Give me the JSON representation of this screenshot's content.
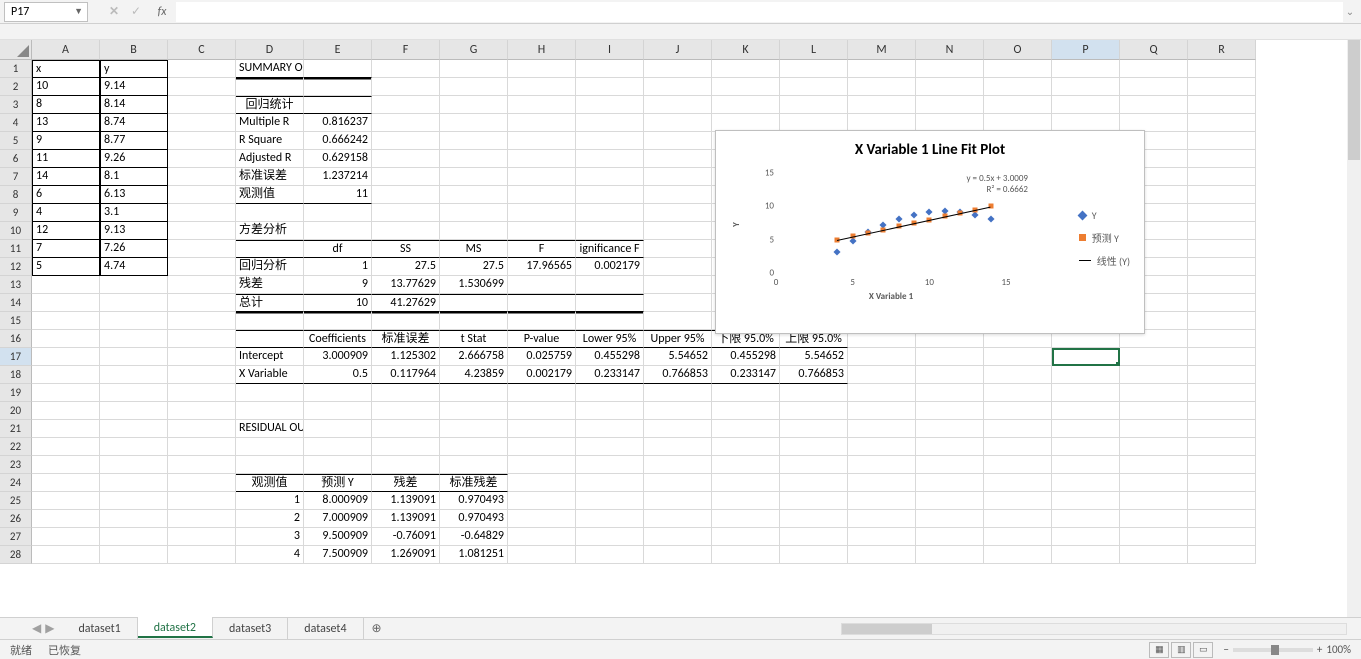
{
  "name_box": "P17",
  "formula": "",
  "fx_label": "fx",
  "columns": [
    "A",
    "B",
    "C",
    "D",
    "E",
    "F",
    "G",
    "H",
    "I",
    "J",
    "K",
    "L",
    "M",
    "N",
    "O",
    "P",
    "Q",
    "R"
  ],
  "rows": 28,
  "selected_col": 15,
  "selected_row": 17,
  "grid": {
    "A1": "x",
    "B1": "y",
    "A2": "10",
    "B2": "9.14",
    "A3": "8",
    "B3": "8.14",
    "A4": "13",
    "B4": "8.74",
    "A5": "9",
    "B5": "8.77",
    "A6": "11",
    "B6": "9.26",
    "A7": "14",
    "B7": "8.1",
    "A8": "6",
    "B8": "6.13",
    "A9": "4",
    "B9": "3.1",
    "A10": "12",
    "B10": "9.13",
    "A11": "7",
    "B11": "7.26",
    "A12": "5",
    "B12": "4.74",
    "D1": "SUMMARY OUTPUT",
    "D3": "回归统计",
    "D4": "Multiple R",
    "E4": "0.816237",
    "D5": "R Square",
    "E5": "0.666242",
    "D6": "Adjusted R",
    "E6": "0.629158",
    "D7": "标准误差",
    "E7": "1.237214",
    "D8": "观测值",
    "E8": "11",
    "D10": "方差分析",
    "E11": "df",
    "F11": "SS",
    "G11": "MS",
    "H11": "F",
    "I11": "ignificance F",
    "D12": "回归分析",
    "E12": "1",
    "F12": "27.5",
    "G12": "27.5",
    "H12": "17.96565",
    "I12": "0.002179",
    "D13": "残差",
    "E13": "9",
    "F13": "13.77629",
    "G13": "1.530699",
    "D14": "总计",
    "E14": "10",
    "F14": "41.27629",
    "E16": "Coefficients",
    "F16": "标准误差",
    "G16": "t Stat",
    "H16": "P-value",
    "I16": "Lower 95%",
    "J16": "Upper 95%",
    "K16": "下限 95.0%",
    "L16": "上限 95.0%",
    "D17": "Intercept",
    "E17": "3.000909",
    "F17": "1.125302",
    "G17": "2.666758",
    "H17": "0.025759",
    "I17": "0.455298",
    "J17": "5.54652",
    "K17": "0.455298",
    "L17": "5.54652",
    "D18": "X Variable",
    "E18": "0.5",
    "F18": "0.117964",
    "G18": "4.23859",
    "H18": "0.002179",
    "I18": "0.233147",
    "J18": "0.766853",
    "K18": "0.233147",
    "L18": "0.766853",
    "D21": "RESIDUAL OUTPUT",
    "D24": "观测值",
    "E24": "预测 Y",
    "F24": "残差",
    "G24": "标准残差",
    "D25": "1",
    "E25": "8.000909",
    "F25": "1.139091",
    "G25": "0.970493",
    "D26": "2",
    "E26": "7.000909",
    "F26": "1.139091",
    "G26": "0.970493",
    "D27": "3",
    "E27": "9.500909",
    "F27": "-0.76091",
    "G27": "-0.64829",
    "D28": "4",
    "E28": "7.500909",
    "F28": "1.269091",
    "G28": "1.081251"
  },
  "tabs": [
    "dataset1",
    "dataset2",
    "dataset3",
    "dataset4"
  ],
  "active_tab": 1,
  "status": {
    "ready": "就绪",
    "recovered": "已恢复",
    "zoom": "100%"
  },
  "chart_data": {
    "type": "scatter-with-fit",
    "title": "X Variable 1 Line Fit  Plot",
    "xlabel": "X Variable 1",
    "ylabel": "Y",
    "x_ticks": [
      0,
      5,
      10,
      15
    ],
    "y_ticks": [
      0,
      5,
      10,
      15
    ],
    "xlim": [
      0,
      15
    ],
    "ylim": [
      0,
      15
    ],
    "equation": "y = 0.5x + 3.0009",
    "r2": "R² = 0.6662",
    "series": [
      {
        "name": "Y",
        "marker": "diamond",
        "color": "#4472c4",
        "points": [
          [
            10,
            9.14
          ],
          [
            8,
            8.14
          ],
          [
            13,
            8.74
          ],
          [
            9,
            8.77
          ],
          [
            11,
            9.26
          ],
          [
            14,
            8.1
          ],
          [
            6,
            6.13
          ],
          [
            4,
            3.1
          ],
          [
            12,
            9.13
          ],
          [
            7,
            7.26
          ],
          [
            5,
            4.74
          ]
        ]
      },
      {
        "name": "预测 Y",
        "marker": "square",
        "color": "#ed7d31",
        "points": [
          [
            10,
            8.0
          ],
          [
            8,
            7.0
          ],
          [
            13,
            9.5
          ],
          [
            9,
            7.5
          ],
          [
            11,
            8.5
          ],
          [
            14,
            10.0
          ],
          [
            6,
            6.0
          ],
          [
            4,
            5.0
          ],
          [
            12,
            9.0
          ],
          [
            7,
            6.5
          ],
          [
            5,
            5.5
          ]
        ]
      }
    ],
    "trendline": {
      "name": "线性 (Y)",
      "slope": 0.5,
      "intercept": 3.0009
    }
  }
}
